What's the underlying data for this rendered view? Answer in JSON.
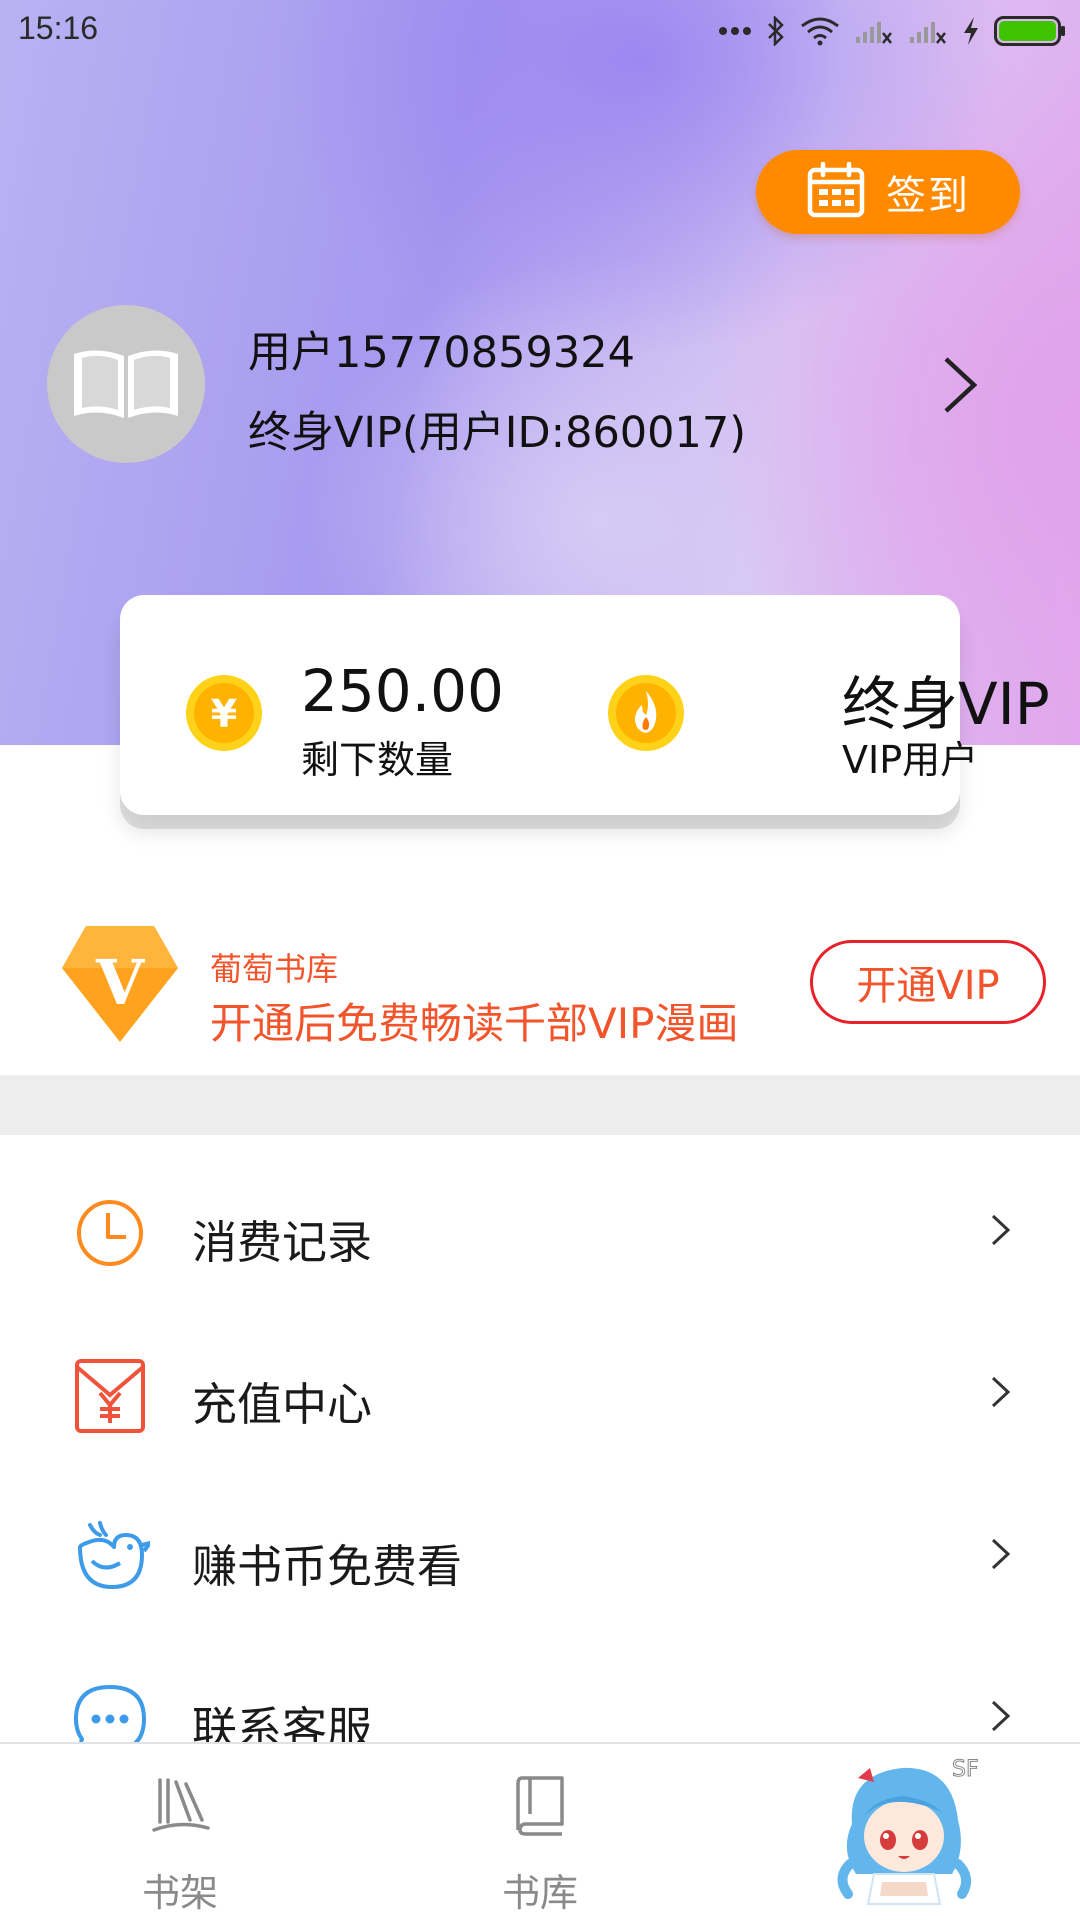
{
  "status_bar": {
    "time": "15:16",
    "icons": [
      "more-dots-icon",
      "bluetooth-icon",
      "wifi-icon",
      "signal-no-service-icon",
      "signal-no-service-icon",
      "charging-icon",
      "battery-icon"
    ],
    "battery_color": "#3ec400"
  },
  "checkin": {
    "label": "签到",
    "icon": "calendar-icon",
    "color": "#ff8a00"
  },
  "profile": {
    "avatar_icon": "open-book-icon",
    "name": "用户15770859324",
    "subtitle": "终身VIP(用户ID:860017)"
  },
  "stats": [
    {
      "icon": "coin-yuan-icon",
      "value": "250.00",
      "label": "剩下数量"
    },
    {
      "icon": "flame-coin-icon",
      "value": "终身VIP",
      "label": "VIP用户"
    }
  ],
  "vip_promo": {
    "logo_letter": "V",
    "brand": "葡萄书库",
    "description": "开通后免费畅读千部VIP漫画",
    "button_label": "开通VIP",
    "accent_color": "#f2552c"
  },
  "menu": [
    {
      "icon": "clock-icon",
      "label": "消费记录",
      "color": "#ff8a1f"
    },
    {
      "icon": "red-envelope-icon",
      "label": "充值中心",
      "color": "#f0533c"
    },
    {
      "icon": "bird-icon",
      "label": "赚书币免费看",
      "color": "#3d9be9"
    },
    {
      "icon": "chat-bubble-icon",
      "label": "联系客服",
      "color": "#3d9be9"
    }
  ],
  "tab_bar": [
    {
      "icon": "bookshelf-icon",
      "label": "书架"
    },
    {
      "icon": "library-book-icon",
      "label": "书库"
    },
    {
      "icon": "mascot-avatar-icon",
      "label": "",
      "badge": "SF"
    }
  ]
}
